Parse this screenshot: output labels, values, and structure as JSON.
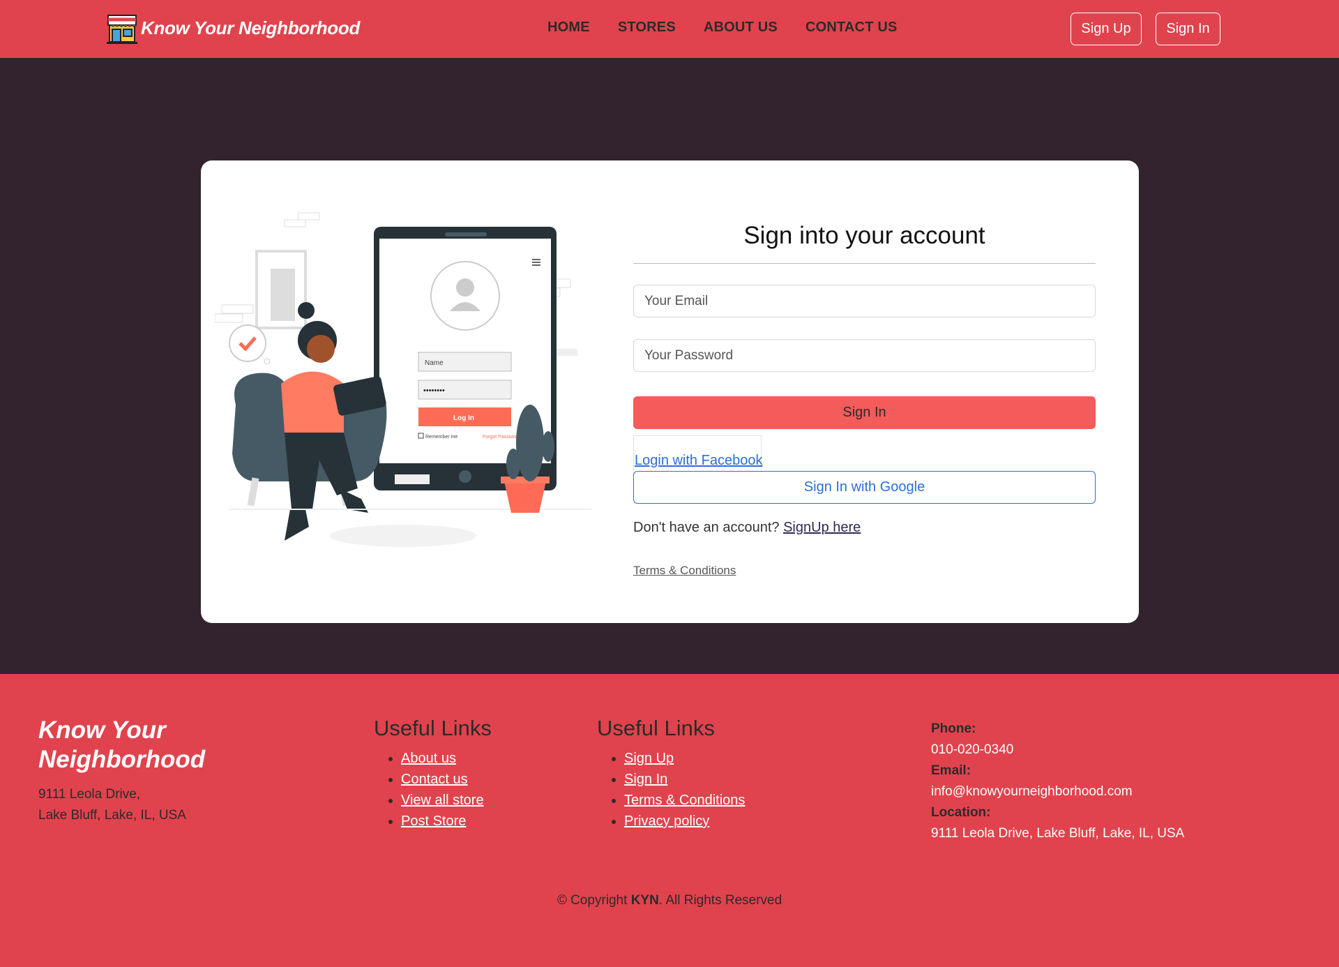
{
  "nav": {
    "brand": "Know Your Neighborhood",
    "links": [
      "HOME",
      "STORES",
      "ABOUT US",
      "CONTACT US"
    ],
    "signup": "Sign Up",
    "signin": "Sign In"
  },
  "form": {
    "title": "Sign into your account",
    "email_placeholder": "Your Email",
    "password_placeholder": "Your Password",
    "signin_button": "Sign In",
    "facebook_link": "Login with Facebook",
    "google_button": "Sign In with Google",
    "no_account_text": "Don't have an account?",
    "signup_link": "SignUp here",
    "terms_link": "Terms & Conditions"
  },
  "illustration": {
    "name_field": "Name",
    "password_dots": "••••••••",
    "login_button": "Log In",
    "remember_me": "Remember me",
    "forgot_password": "Forgot Password?"
  },
  "footer": {
    "brand": "Know Your Neighborhood",
    "address_line1": "9111 Leola Drive,",
    "address_line2": "Lake Bluff, Lake, IL, USA",
    "col1": {
      "title": "Useful Links",
      "links": [
        "About us",
        "Contact us",
        "View all store",
        "Post Store"
      ]
    },
    "col2": {
      "title": "Useful Links",
      "links": [
        "Sign Up",
        "Sign In",
        "Terms & Conditions",
        "Privacy policy"
      ]
    },
    "contact": {
      "phone_label": "Phone:",
      "phone": "010-020-0340",
      "email_label": "Email:",
      "email": "info@knowyourneighborhood.com",
      "location_label": "Location:",
      "location": "9111 Leola Drive, Lake Bluff, Lake, IL, USA"
    },
    "copyright_prefix": "© Copyright",
    "copyright_brand": "KYN",
    "copyright_suffix": ". All Rights Reserved"
  },
  "colors": {
    "primary": "#e0434d",
    "background": "#33232f",
    "button": "#f45b5b",
    "link_blue": "#2a6fd6"
  }
}
